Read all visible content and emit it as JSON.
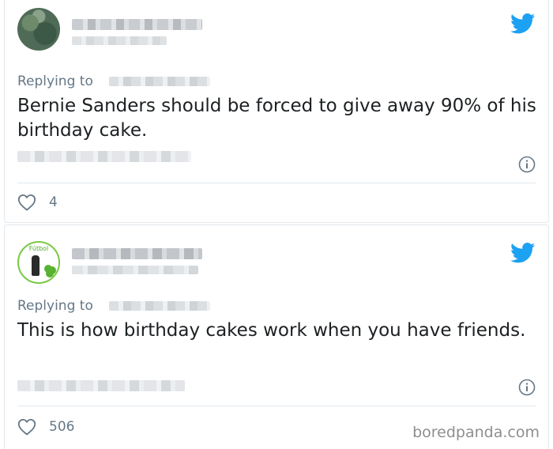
{
  "tweets": [
    {
      "replying_label": "Replying to",
      "text": "Bernie Sanders should be forced to give away 90% of his birthday cake.",
      "like_count": "4"
    },
    {
      "avatar_text": "Fútbol",
      "replying_label": "Replying to",
      "text": "This is how birthday cakes work when you have friends.",
      "like_count": "506"
    }
  ],
  "watermark": "boredpanda.com",
  "colors": {
    "twitter_blue": "#1da1f2",
    "muted_text": "#657786",
    "divider": "#e1e8ed"
  },
  "icons": [
    "twitter-bird-icon",
    "info-icon",
    "heart-icon"
  ]
}
